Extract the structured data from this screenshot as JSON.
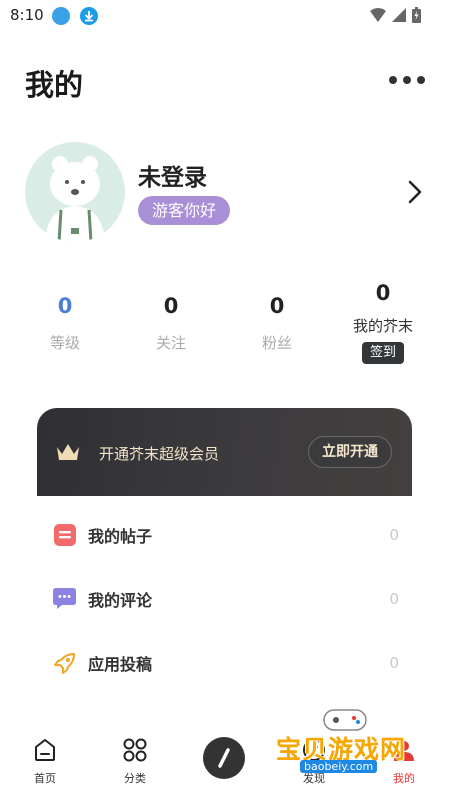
{
  "status_bar": {
    "time": "8:10"
  },
  "header": {
    "title": "我的"
  },
  "profile": {
    "name": "未登录",
    "badge": "游客你好"
  },
  "stats": [
    {
      "value": "0",
      "label": "等级"
    },
    {
      "value": "0",
      "label": "关注"
    },
    {
      "value": "0",
      "label": "粉丝"
    },
    {
      "value": "0",
      "label": "我的芥末",
      "button": "签到"
    }
  ],
  "vip": {
    "text": "开通芥末超级会员",
    "button": "立即开通"
  },
  "menu": [
    {
      "label": "我的帖子",
      "count": "0",
      "icon": "post-icon"
    },
    {
      "label": "我的评论",
      "count": "0",
      "icon": "comment-icon"
    },
    {
      "label": "应用投稿",
      "count": "0",
      "icon": "rocket-icon"
    }
  ],
  "bottom_nav": [
    {
      "label": "首页",
      "icon": "home-icon"
    },
    {
      "label": "分类",
      "icon": "category-icon"
    },
    {
      "label": "发现",
      "icon": "discover-icon"
    },
    {
      "label": "我的",
      "icon": "profile-icon"
    }
  ],
  "watermark": {
    "text": "宝贝游戏网",
    "url": "baobeiy.com"
  },
  "colors": {
    "accent_purple": "#a98fd6",
    "level_blue": "#4b7fd9",
    "vip_gold": "#f2e4c9",
    "active_red": "#e53935"
  }
}
